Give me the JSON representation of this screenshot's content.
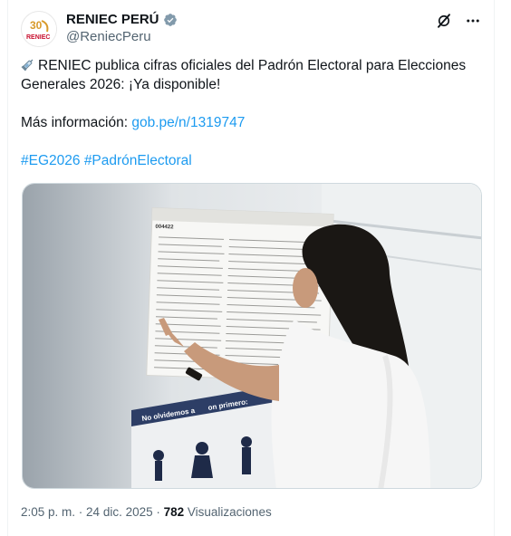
{
  "account": {
    "display_name": "RENIEC PERÚ",
    "handle": "@ReniecPeru",
    "avatar_text": "RENIEC",
    "avatar_badge": "30"
  },
  "tweet": {
    "line1_text": "RENIEC publica cifras oficiales del Padrón Electoral para Elecciones",
    "line2_text": "Generales 2026: ¡Ya disponible!",
    "more_info_label": "Más información: ",
    "more_info_link": "gob.pe/n/1319747",
    "hashtag_1": "#EG2026",
    "hashtag_2": "#PadrónElectoral"
  },
  "media": {
    "sheet_code": "004422",
    "banner_text": "No olvidemos a",
    "banner_text_2": "on primero:"
  },
  "meta": {
    "time": "2:05 p. m.",
    "separator": " · ",
    "date": "24 dic. 2025",
    "views_count": "782",
    "views_label": " Visualizaciones"
  },
  "colors": {
    "link": "#1d9bf0",
    "verified": "#829aab",
    "secondary_text": "#536471"
  }
}
